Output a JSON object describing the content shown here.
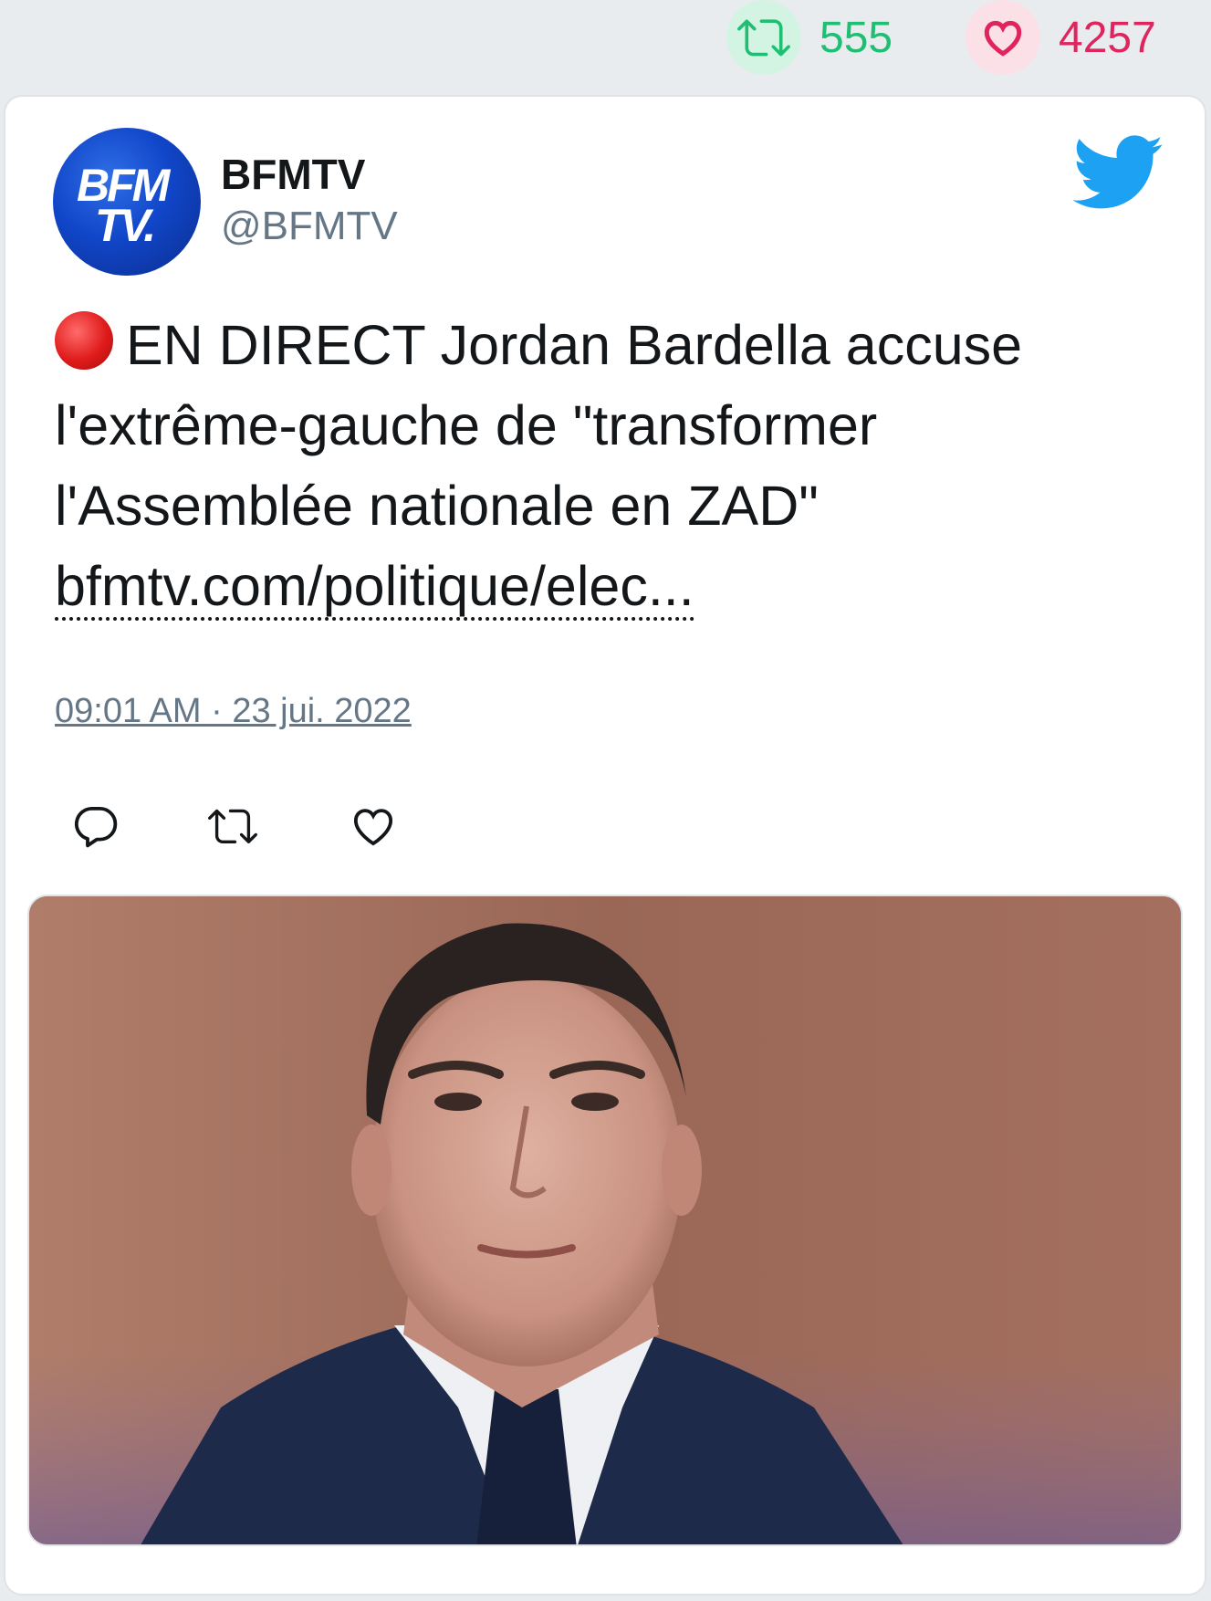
{
  "stats": {
    "retweets": "555",
    "likes": "4257",
    "retweet_color": "#1fbf73",
    "like_color": "#e0245e"
  },
  "tweet": {
    "author_name": "BFMTV",
    "author_handle": "@BFMTV",
    "avatar_text_line1": "BFM",
    "avatar_text_line2": "TV.",
    "icon": "red-circle-emoji",
    "text": "EN DIRECT Jordan Bardella accuse l'extrême-gauche de \"transformer l'Assemblée nationale en ZAD\"",
    "link": "bfmtv.com/politique/elec...",
    "timestamp": "09:01 AM · 23 jui. 2022",
    "brand_color": "#1da1f2"
  },
  "actions": [
    "reply-icon",
    "retweet-icon",
    "like-icon"
  ],
  "media": {
    "type": "photo"
  }
}
